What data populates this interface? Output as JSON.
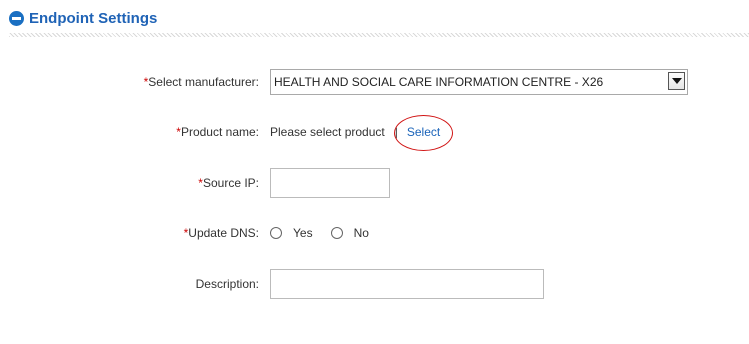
{
  "section": {
    "title": "Endpoint Settings"
  },
  "form": {
    "required_marker": "*",
    "manufacturer": {
      "label": "Select manufacturer:",
      "value": "HEALTH AND SOCIAL CARE INFORMATION CENTRE - X26"
    },
    "product": {
      "label": "Product name:",
      "value": "Please select product",
      "separator": "|",
      "link": "Select"
    },
    "source_ip": {
      "label": "Source IP:",
      "value": ""
    },
    "update_dns": {
      "label": "Update DNS:",
      "options": [
        "Yes",
        "No"
      ],
      "selected": null
    },
    "description": {
      "label": "Description:",
      "value": ""
    }
  }
}
